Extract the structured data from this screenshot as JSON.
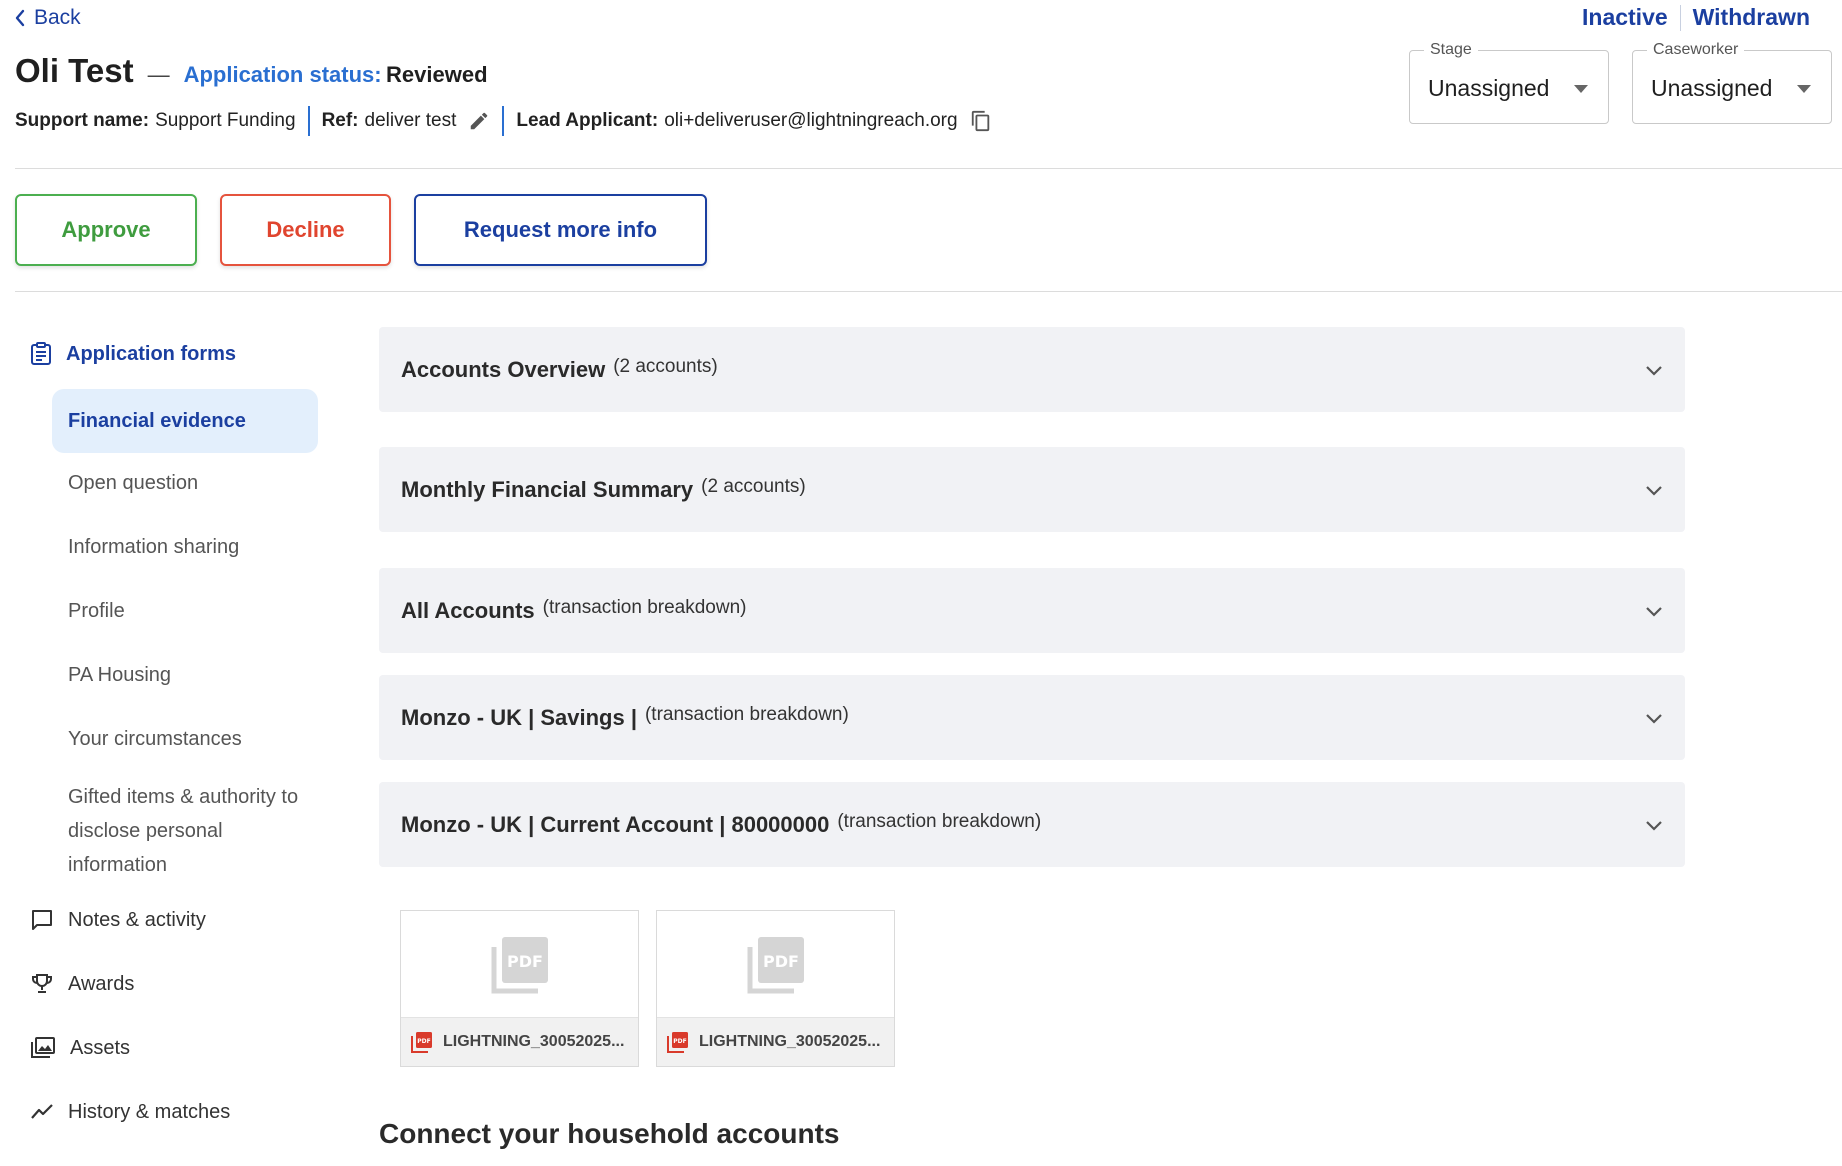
{
  "header": {
    "back_label": "Back",
    "links": [
      "Inactive",
      "Withdrawn"
    ],
    "title": "Oli Test",
    "dash": "—",
    "status_label": "Application status:",
    "status_value": "Reviewed",
    "support_label": "Support name:",
    "support_value": "Support Funding",
    "ref_label": "Ref:",
    "ref_value": "deliver test",
    "lead_label": "Lead Applicant:",
    "lead_value": "oli+deliveruser@lightningreach.org"
  },
  "selects": {
    "stage": {
      "label": "Stage",
      "value": "Unassigned"
    },
    "caseworker": {
      "label": "Caseworker",
      "value": "Unassigned"
    }
  },
  "actions": {
    "approve": "Approve",
    "decline": "Decline",
    "request_info": "Request more info"
  },
  "sidebar": {
    "section_label": "Application forms",
    "sub_items": [
      "Financial evidence",
      "Open question",
      "Information sharing",
      "Profile",
      "PA Housing",
      "Your circumstances",
      "Gifted items & authority to disclose personal information"
    ],
    "items": [
      "Notes & activity",
      "Awards",
      "Assets",
      "History & matches"
    ]
  },
  "accordions": [
    {
      "title": "Accounts Overview",
      "note": "(2 accounts)"
    },
    {
      "title": "Monthly Financial Summary",
      "note": "(2 accounts)"
    },
    {
      "title": "All Accounts",
      "note": "(transaction breakdown)"
    },
    {
      "title": "Monzo - UK | Savings |",
      "note": "(transaction breakdown)"
    },
    {
      "title": "Monzo - UK | Current Account | 80000000",
      "note": "(transaction breakdown)"
    }
  ],
  "files": [
    {
      "name": "LIGHTNING_30052025...",
      "badge": "PDF"
    },
    {
      "name": "LIGHTNING_30052025...",
      "badge": "PDF"
    }
  ],
  "section_heading": "Connect your household accounts",
  "colors": {
    "primary": "#1b3fa0",
    "link": "#2a6fd1",
    "approve": "#4caf50",
    "decline": "#e5533d",
    "active_bg": "#e3effc",
    "pdf_red": "#d93a2b"
  }
}
